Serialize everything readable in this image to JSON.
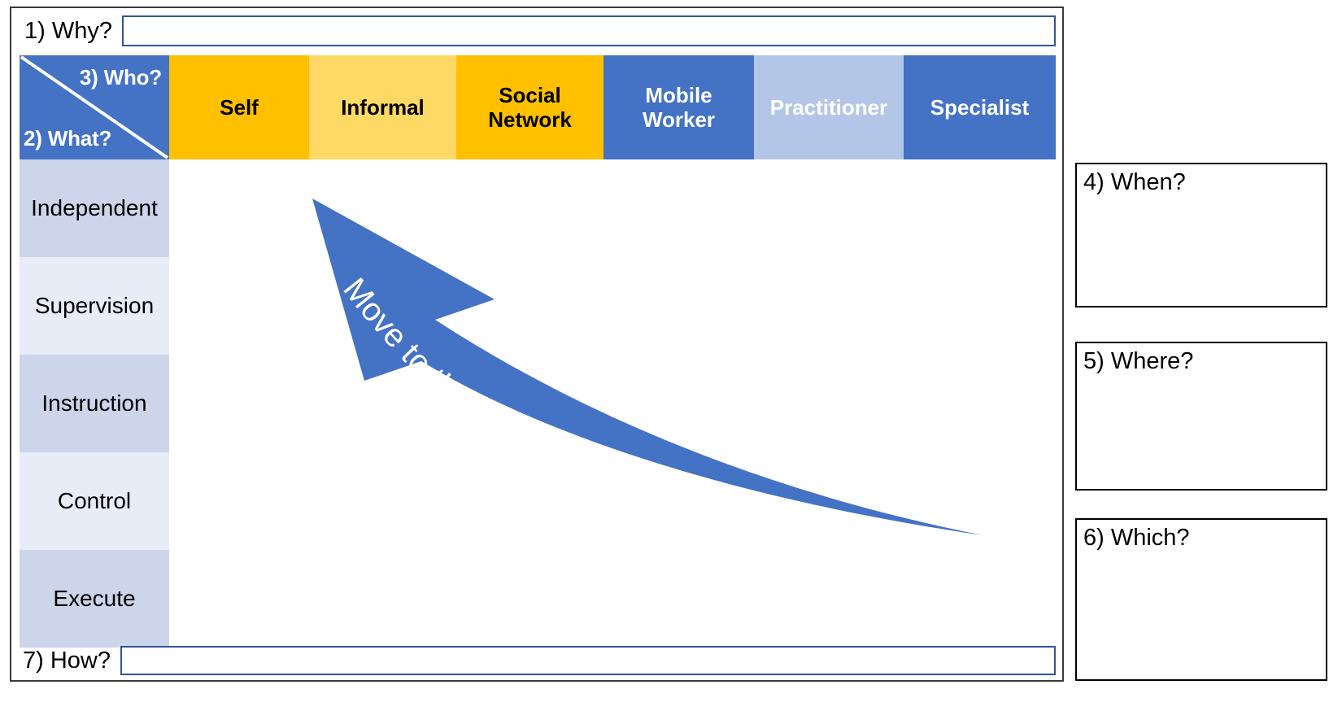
{
  "frame": {
    "why": {
      "label": "1) Why?",
      "value": "",
      "placeholder": ""
    },
    "how": {
      "label": "7) How?",
      "value": "",
      "placeholder": ""
    }
  },
  "matrix": {
    "corner": {
      "who_label": "3) Who?",
      "what_label": "2) What?",
      "background": "#4472c4",
      "diagonal_color": "#ffffff"
    },
    "columns": [
      {
        "label": "Self",
        "bg": "#ffc000",
        "fg": "#000000"
      },
      {
        "label": "Informal",
        "bg": "#ffd966",
        "fg": "#000000"
      },
      {
        "label": "Social\nNetwork",
        "line1": "Social",
        "line2": "Network",
        "bg": "#ffc000",
        "fg": "#000000"
      },
      {
        "label": "Mobile\nWorker",
        "line1": "Mobile",
        "line2": "Worker",
        "bg": "#4472c4",
        "fg": "#ffffff"
      },
      {
        "label": "Practitioner",
        "bg": "#b4c6e7",
        "fg": "#ffffff"
      },
      {
        "label": "Specialist",
        "bg": "#4472c4",
        "fg": "#ffffff"
      }
    ],
    "rows": [
      {
        "label": "Independent",
        "bg": "#ccd5ea"
      },
      {
        "label": "Supervision",
        "bg": "#e8ecf7"
      },
      {
        "label": "Instruction",
        "bg": "#ccd5ea"
      },
      {
        "label": "Control",
        "bg": "#e8ecf7"
      },
      {
        "label": "Execute",
        "bg": "#ccd5ea"
      }
    ],
    "annotation": {
      "arrow_text": "Move to the upper left",
      "arrow_color": "#4472c4",
      "arrow_text_color": "#ffffff",
      "direction": "upper-left"
    }
  },
  "side_boxes": [
    {
      "label": "4) When?",
      "value": ""
    },
    {
      "label": "5) Where?",
      "value": ""
    },
    {
      "label": "6) Which?",
      "value": ""
    }
  ]
}
